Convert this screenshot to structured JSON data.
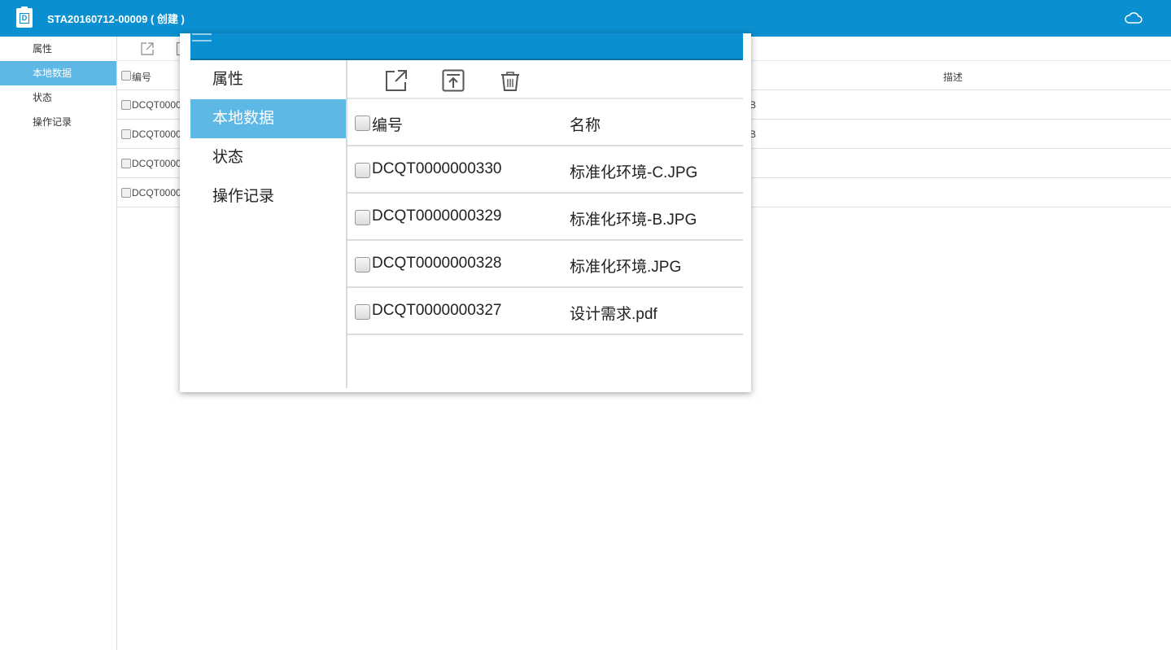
{
  "header": {
    "title": "STA20160712-00009 ( 创建 )",
    "app_icon_letter": "D",
    "bg_color": "#0a8fd0"
  },
  "sidebar": {
    "items": [
      {
        "label": "属性",
        "active": false
      },
      {
        "label": "本地数据",
        "active": true
      },
      {
        "label": "状态",
        "active": false
      },
      {
        "label": "操作记录",
        "active": false
      }
    ]
  },
  "toolbar": {
    "icons": [
      "open-external-icon",
      "upload-icon",
      "delete-icon"
    ]
  },
  "table": {
    "headers": {
      "code": "编号",
      "name": "名称",
      "desc": "描述"
    },
    "rows": [
      {
        "code": "DCQT0000000330",
        "name": "标准化环境-C.JPG"
      },
      {
        "code": "DCQT0000000329",
        "name": "标准化环境-B.JPG"
      },
      {
        "code": "DCQT0000000328",
        "name": "标准化环境.JPG"
      },
      {
        "code": "DCQT0000000327",
        "name": "设计需求.pdf"
      }
    ]
  },
  "background": {
    "visible_codes": [
      "DCQT0000",
      "DCQT0000",
      "DCQT0000",
      "DCQT0000"
    ],
    "partial_size_column": [
      "B",
      "B",
      "",
      ""
    ]
  },
  "colors": {
    "accent": "#0a8fd0",
    "active_item": "#5eb8e6"
  }
}
